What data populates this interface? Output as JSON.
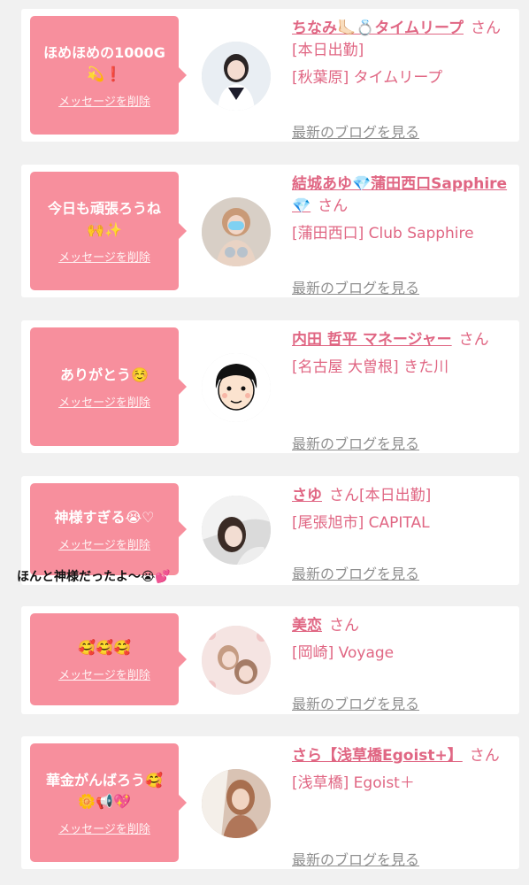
{
  "cards": [
    {
      "message": "ほめほめの1000G\n💫❗",
      "delete_label": "メッセージを削除",
      "name": "ちなみ🦶🏻💍タイムリープ",
      "san": "さん",
      "status": "[本日出勤]",
      "shop": "[秋葉原] タイムリープ",
      "blog": "最新のブログを見る"
    },
    {
      "message": "今日も頑張ろうね\n🙌✨",
      "delete_label": "メッセージを削除",
      "name": "結城あゆ💎蒲田西口Sapphire💎",
      "san": "さん",
      "status": "",
      "shop": "[蒲田西口] Club Sapphire",
      "blog": "最新のブログを見る"
    },
    {
      "message": "ありがとう☺️",
      "delete_label": "メッセージを削除",
      "name": "内田 哲平 マネージャー",
      "san": "さん",
      "status": "",
      "shop": "[名古屋 大曽根] きた川",
      "blog": "最新のブログを見る"
    },
    {
      "message": "神様すぎる😭♡",
      "delete_label": "メッセージを削除",
      "name": "さゆ",
      "san": "さん",
      "status": "[本日出勤]",
      "shop": "[尾張旭市] CAPITAL",
      "blog": "最新のブログを見る"
    },
    {
      "message": "🥰🥰🥰",
      "delete_label": "メッセージを削除",
      "name": "美恋",
      "san": "さん",
      "status": "",
      "shop": "[岡崎] Voyage",
      "blog": "最新のブログを見る"
    },
    {
      "message": "華金がんばろう🥰\n🌼📢💖",
      "delete_label": "メッセージを削除",
      "name": "さら【浅草橋Egoist+】",
      "san": "さん",
      "status": "",
      "shop": "[浅草橋] Egoist＋",
      "blog": "最新のブログを見る"
    }
  ],
  "overlay_caption": "ほんと神様だったよ〜😭💕"
}
